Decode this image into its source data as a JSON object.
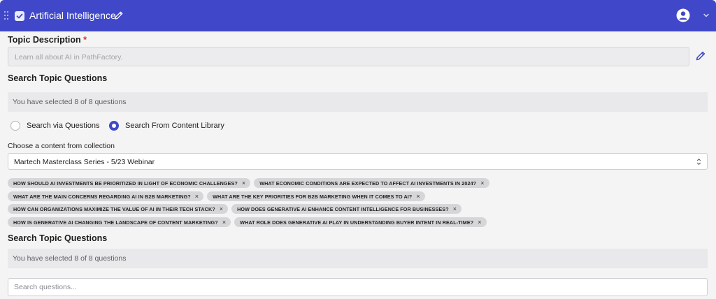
{
  "header": {
    "title": "Artificial Intelligence",
    "bg_color": "#4048c9"
  },
  "topic_description": {
    "label": "Topic Description",
    "required_mark": "*",
    "value": "Learn all about AI in PathFactory."
  },
  "search_topic_questions_1": {
    "label": "Search Topic Questions",
    "selected_text": "You have selected 8 of 8 questions"
  },
  "search_mode": {
    "options": [
      {
        "label": "Search via Questions",
        "selected": false
      },
      {
        "label": "Search From Content Library",
        "selected": true
      }
    ]
  },
  "collection": {
    "label": "Choose a content from collection",
    "selected_value": "Martech Masterclass Series - 5/23 Webinar"
  },
  "chips": [
    [
      "HOW SHOULD AI INVESTMENTS BE PRIORITIZED IN LIGHT OF ECONOMIC CHALLENGES?",
      "WHAT ECONOMIC CONDITIONS ARE EXPECTED TO AFFECT AI INVESTMENTS IN 2024?"
    ],
    [
      "WHAT ARE THE MAIN CONCERNS REGARDING AI IN B2B MARKETING?",
      "WHAT ARE THE KEY PRIORITIES FOR B2B MARKETING WHEN IT COMES TO AI?"
    ],
    [
      "HOW CAN ORGANIZATIONS MAXIMIZE THE VALUE OF AI IN THEIR TECH STACK?",
      "HOW DOES GENERATIVE AI ENHANCE CONTENT INTELLIGENCE FOR BUSINESSES?"
    ],
    [
      "HOW IS GENERATIVE AI CHANGING THE LANDSCAPE OF CONTENT MARKETING?",
      "WHAT ROLE DOES GENERATIVE AI PLAY IN UNDERSTANDING BUYER INTENT IN REAL-TIME?"
    ]
  ],
  "chip_remove_glyph": "×",
  "search_topic_questions_2": {
    "label": "Search Topic Questions",
    "selected_text": "You have selected 8 of 8 questions"
  },
  "search": {
    "placeholder": "Search questions..."
  }
}
